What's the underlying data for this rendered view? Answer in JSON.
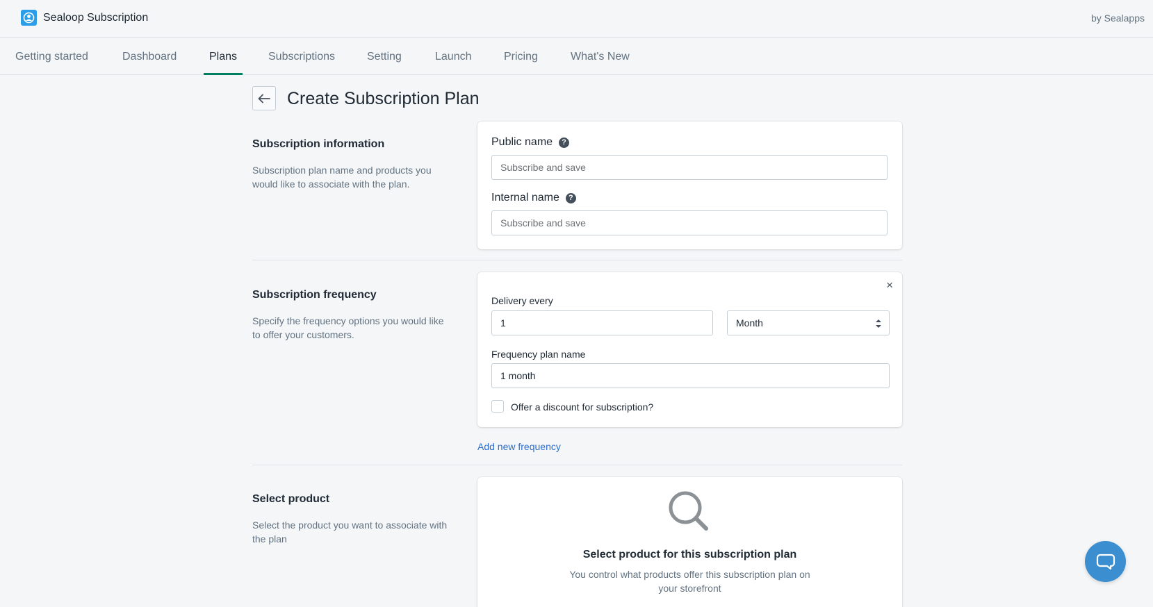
{
  "header": {
    "app_name": "Sealoop Subscription",
    "by_line": "by Sealapps"
  },
  "nav": {
    "tabs": [
      {
        "label": "Getting started"
      },
      {
        "label": "Dashboard"
      },
      {
        "label": "Plans",
        "active": true
      },
      {
        "label": "Subscriptions"
      },
      {
        "label": "Setting"
      },
      {
        "label": "Launch"
      },
      {
        "label": "Pricing"
      },
      {
        "label": "What's New"
      }
    ]
  },
  "page": {
    "title": "Create Subscription Plan"
  },
  "info_section": {
    "heading": "Subscription information",
    "description": "Subscription plan name and products you would like to associate with the plan.",
    "public_name_label": "Public name",
    "public_name_placeholder": "Subscribe and save",
    "internal_name_label": "Internal name",
    "internal_name_placeholder": "Subscribe and save",
    "help_icon": "question-circle-icon"
  },
  "frequency_section": {
    "heading": "Subscription frequency",
    "description": "Specify the frequency options you would like to offer your customers.",
    "close_symbol": "×",
    "delivery_label": "Delivery every",
    "delivery_value": "1",
    "interval_value": "Month",
    "plan_name_label": "Frequency plan name",
    "plan_name_value": "1 month",
    "discount_label": "Offer a discount for subscription?",
    "discount_checked": false,
    "add_link": "Add new frequency"
  },
  "product_section": {
    "heading": "Select product",
    "description": "Select the product you want to associate with the plan",
    "empty_icon": "search-icon",
    "empty_title": "Select product for this subscription plan",
    "empty_desc": "You control what products offer this subscription plan on your storefront"
  },
  "colors": {
    "accent": "#008060",
    "link": "#2c6ecb",
    "chat": "#3b8fd0",
    "logo": "#2c9ee8"
  }
}
